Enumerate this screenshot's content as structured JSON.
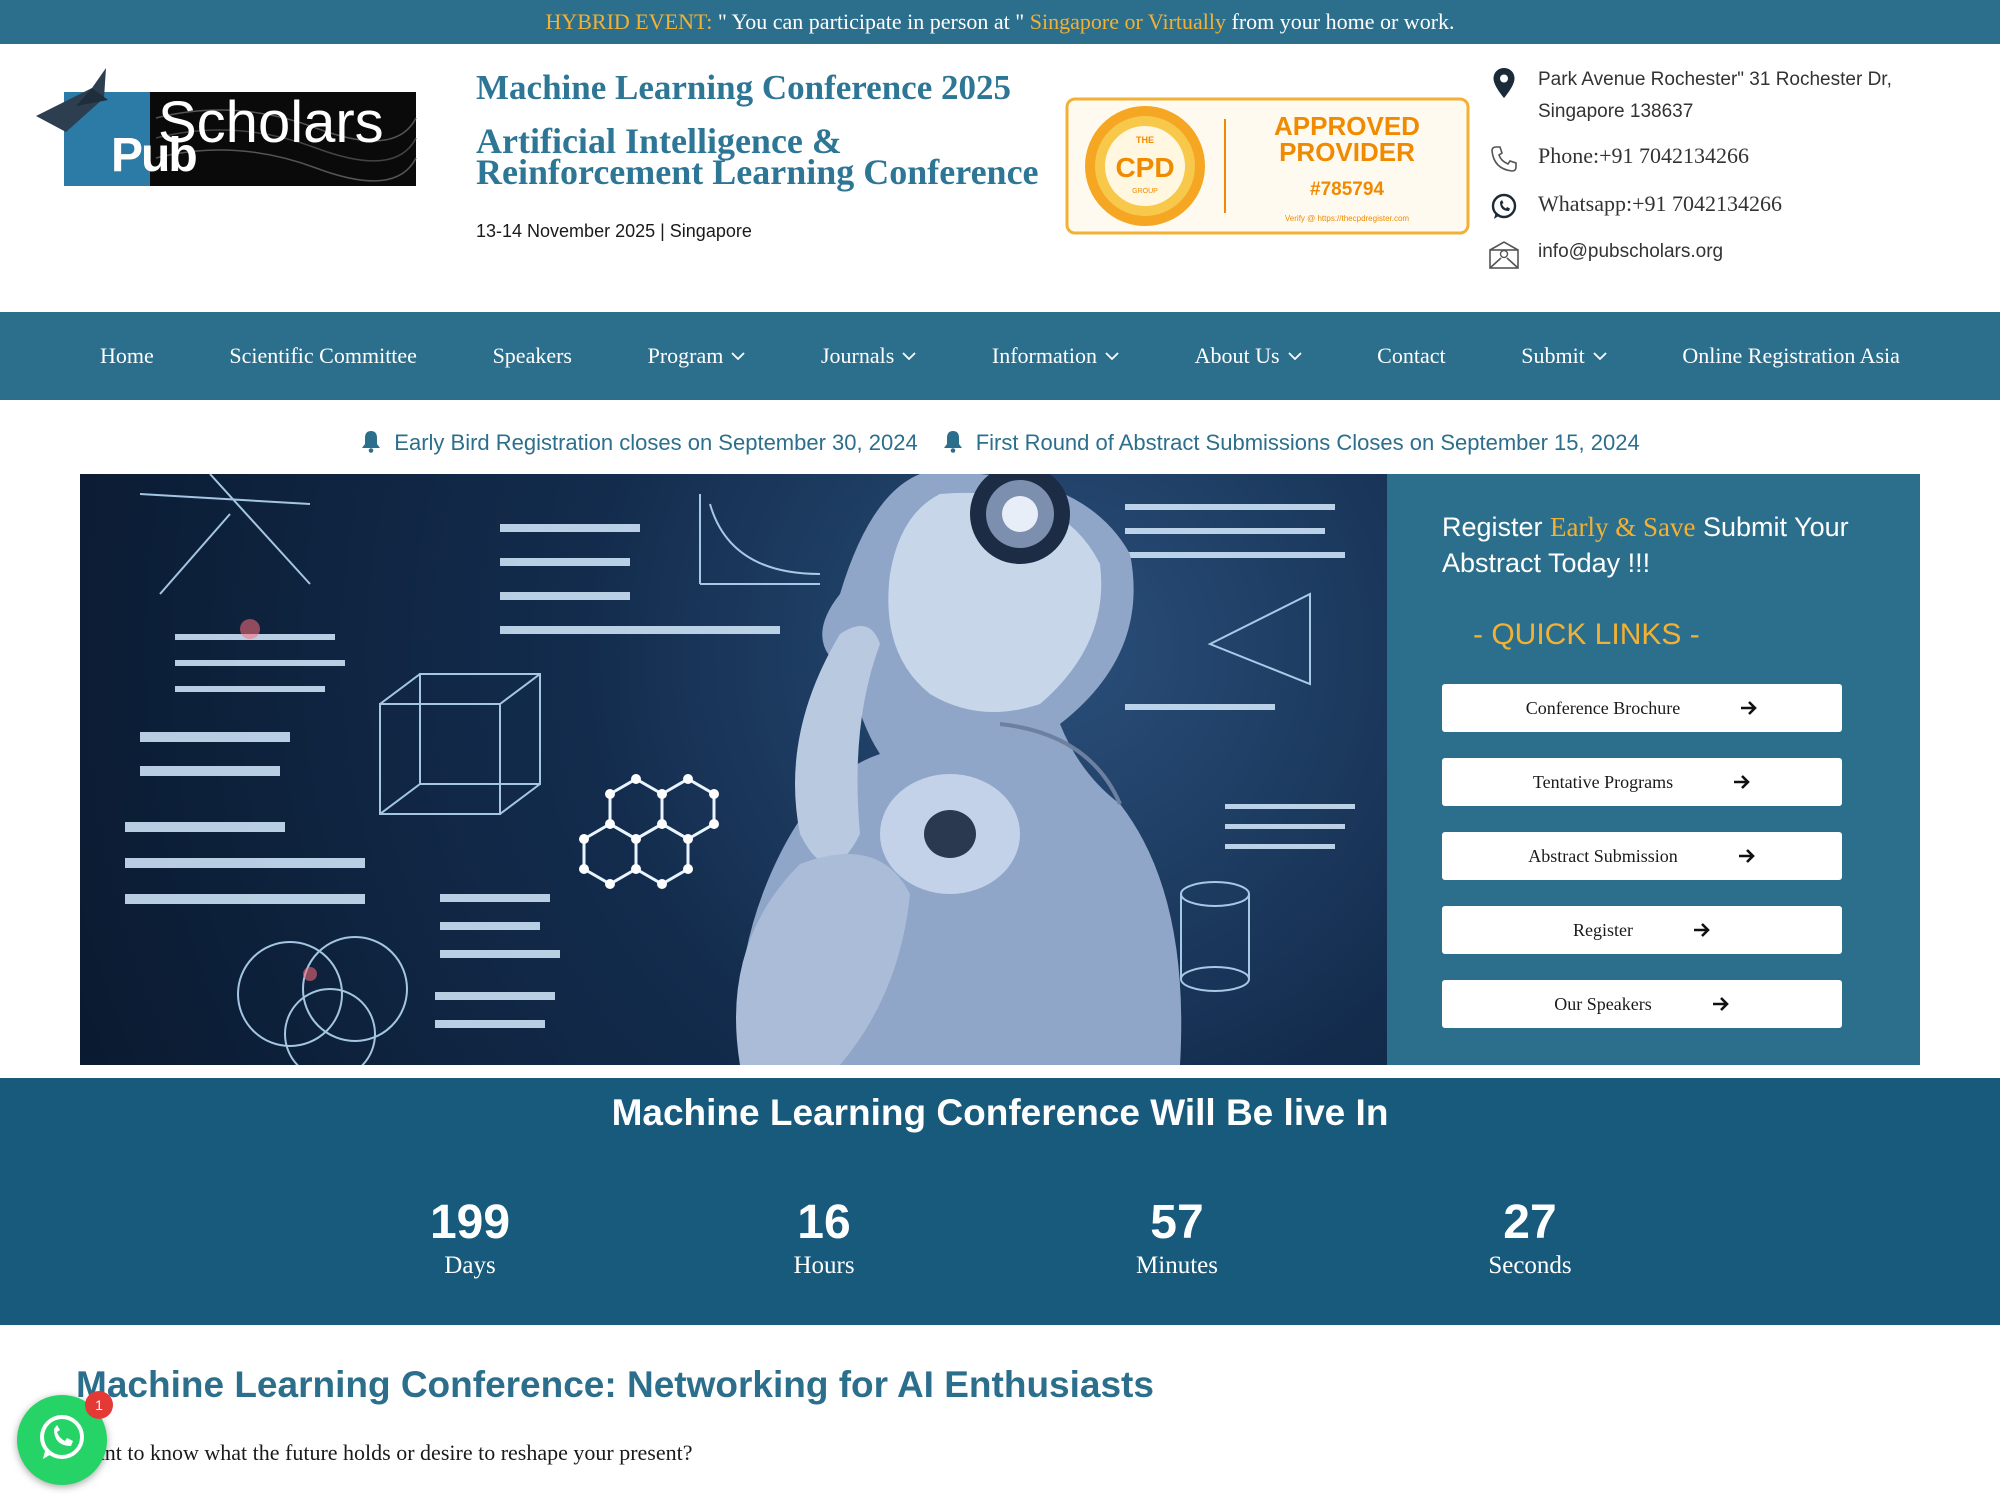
{
  "topbar": {
    "prefix": "HYBRID EVENT:",
    "text1": " \" You can participate in person at \" ",
    "highlight": "Singapore or Virtually",
    "text2": " from your home or work."
  },
  "header": {
    "logo": {
      "word": "Scholars",
      "letters": "Pub"
    },
    "title": "Machine Learning Conference 2025",
    "subtitle": "Artificial Intelligence & Reinforcement Learning Conference",
    "date": "13-14 November 2025 | Singapore",
    "badge": {
      "seal_top": "THE",
      "seal_main": "CPD",
      "seal_bottom": "GROUP",
      "line1": "APPROVED",
      "line2": "PROVIDER",
      "number": "#785794",
      "verify": "Verify @ https://thecpdregister.com"
    },
    "contact": {
      "address": "Park Avenue Rochester\" 31 Rochester Dr, Singapore 138637",
      "phone": "Phone:+91 7042134266",
      "whatsapp": "Whatsapp:+91 7042134266",
      "email": "info@pubscholars.org"
    }
  },
  "nav": {
    "items": [
      {
        "label": "Home"
      },
      {
        "label": "Scientific Committee"
      },
      {
        "label": "Speakers"
      },
      {
        "label": "Program"
      },
      {
        "label": "Journals"
      },
      {
        "label": "Information"
      },
      {
        "label": "About Us"
      },
      {
        "label": "Contact"
      },
      {
        "label": "Submit"
      },
      {
        "label": "Online Registration Asia"
      }
    ]
  },
  "notices": [
    "Early Bird Registration closes on September 30, 2024",
    "First Round of Abstract Submissions Closes on September 15, 2024"
  ],
  "quick": {
    "promo_a": "Register ",
    "promo_hl": "Early & Save",
    "promo_b": " Submit Your Abstract Today !!!",
    "title": "- QUICK LINKS -",
    "links": [
      {
        "label": "Conference Brochure"
      },
      {
        "label": "Tentative Programs"
      },
      {
        "label": "Abstract Submission"
      },
      {
        "label": "Register"
      },
      {
        "label": "Our Speakers"
      }
    ]
  },
  "countdown": {
    "title": "Machine Learning Conference Will Be live In",
    "days": "199",
    "days_label": "Days",
    "hours": "16",
    "hours_label": "Hours",
    "minutes": "57",
    "minutes_label": "Minutes",
    "seconds": "27",
    "seconds_label": "Seconds"
  },
  "intro": {
    "title": "Machine Learning Conference: Networking for AI Enthusiasts",
    "text": "Want to know what the future holds or desire to reshape your present?"
  },
  "whatsapp_badge": "1",
  "colors": {
    "brand": "#2c6f8c",
    "accent": "#f2b134",
    "countdown_bg": "#185a7c",
    "whatsapp": "#25d366"
  },
  "icons": [
    "map-pin-icon",
    "phone-icon",
    "whatsapp-icon",
    "mail-icon",
    "chevron-down-icon",
    "bell-icon",
    "arrow-right-icon"
  ]
}
